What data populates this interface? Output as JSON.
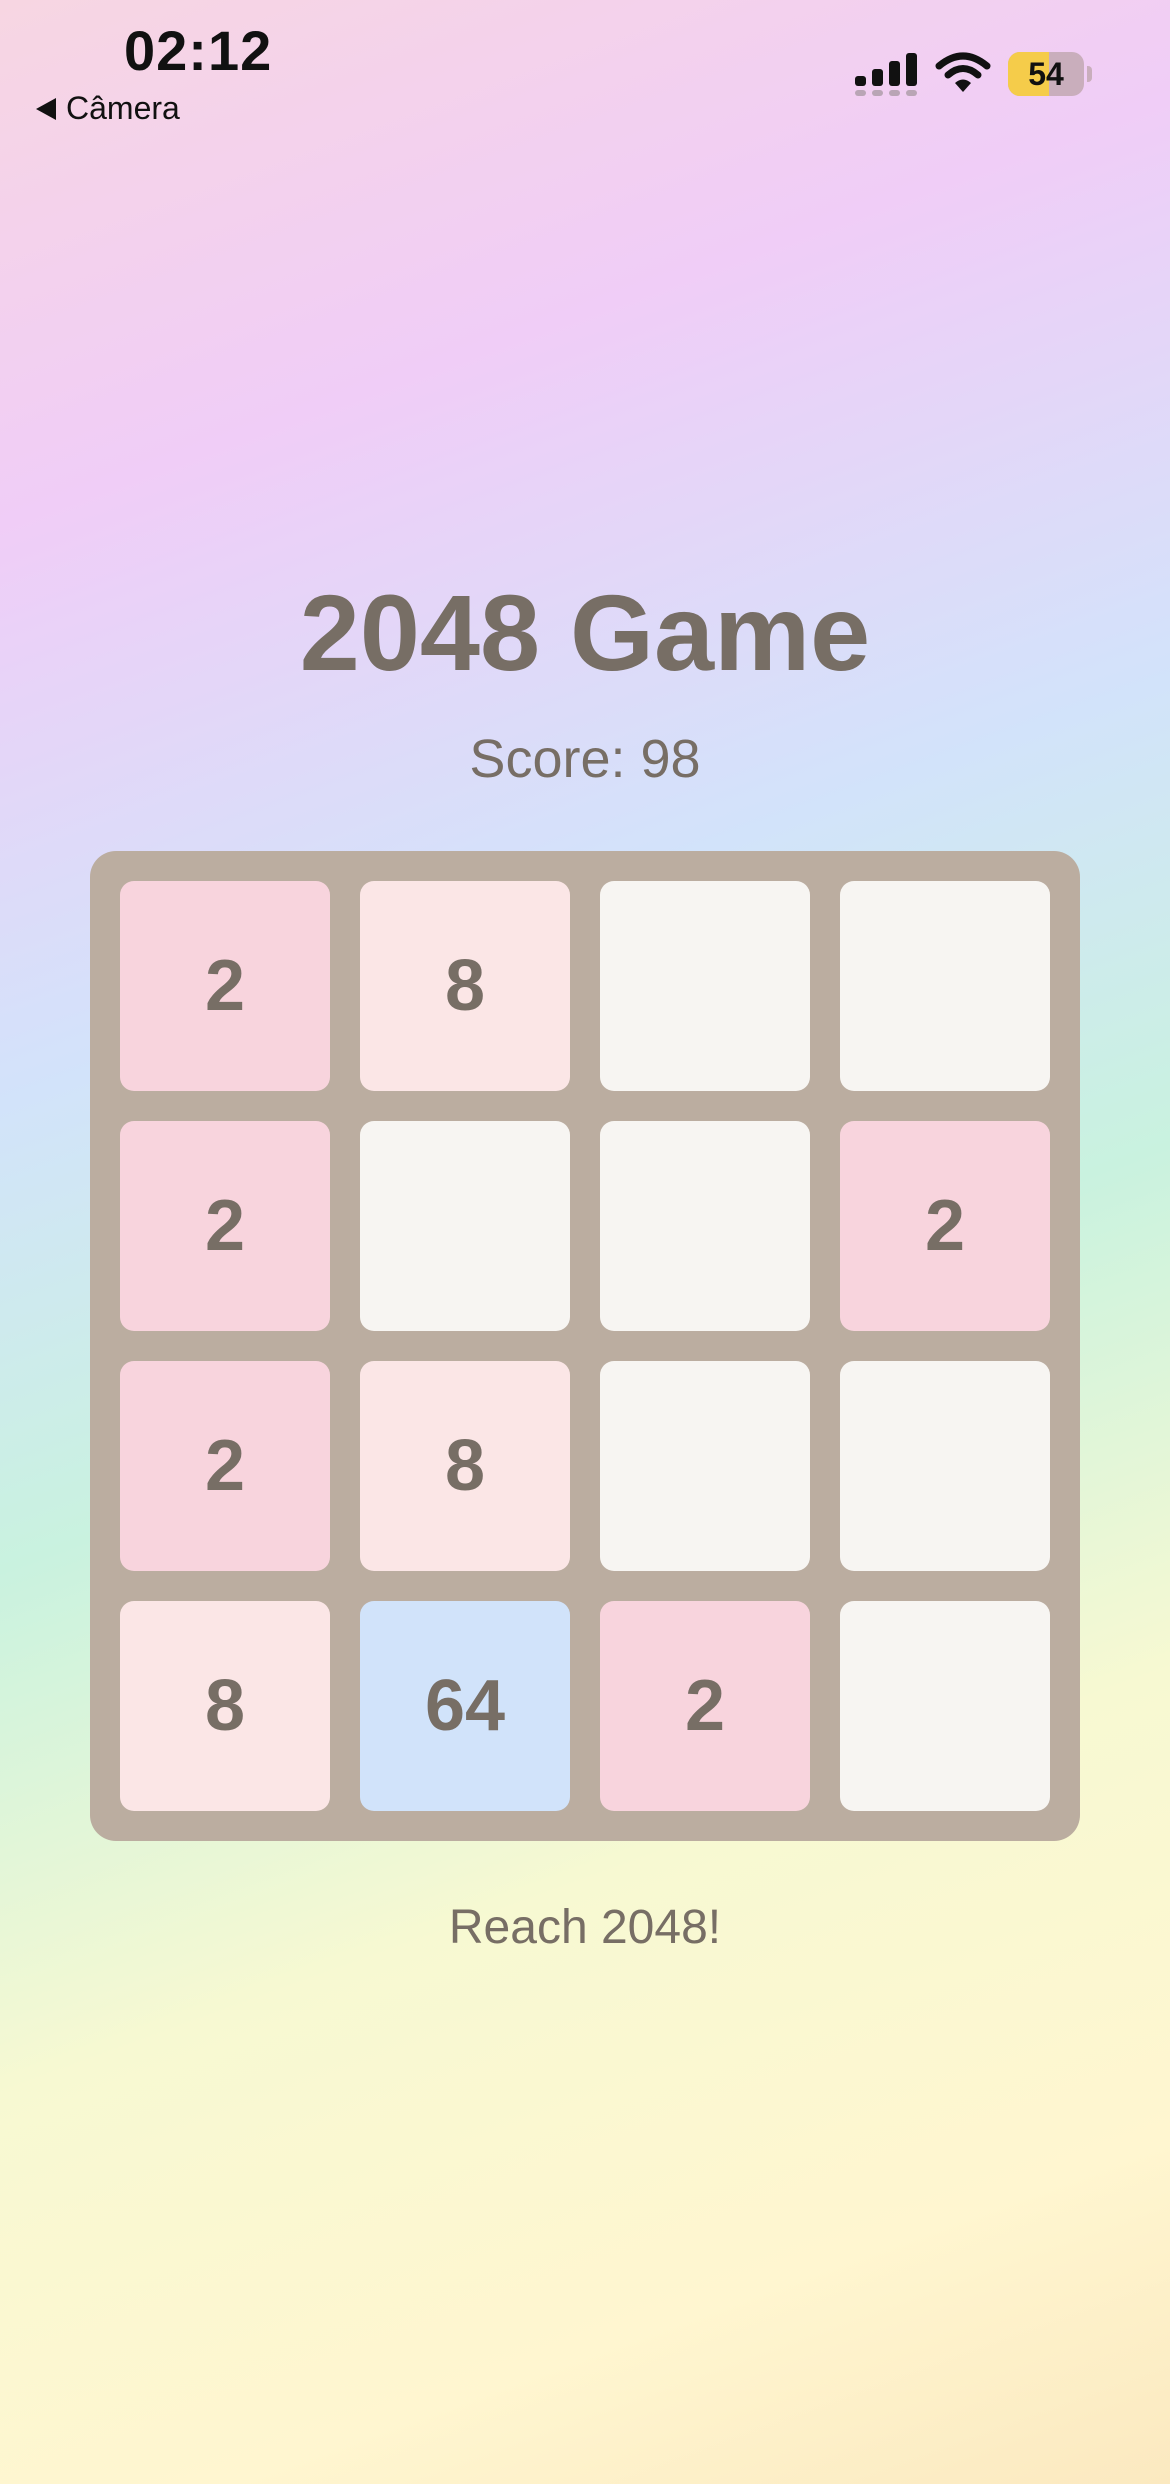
{
  "status_bar": {
    "time": "02:12",
    "back_label": "Câmera",
    "battery_level": "54",
    "battery_percent": 54,
    "icons": [
      "signal-icon",
      "wifi-icon",
      "battery-icon"
    ]
  },
  "game": {
    "title": "2048 Game",
    "score_text": "Score: 98",
    "hint": "Reach 2048!",
    "board": [
      [
        "2",
        "8",
        "",
        ""
      ],
      [
        "2",
        "",
        "",
        "2"
      ],
      [
        "2",
        "8",
        "",
        ""
      ],
      [
        "8",
        "64",
        "2",
        ""
      ]
    ]
  },
  "colors": {
    "text": "#776e65",
    "board": "#bbada0",
    "empty_tile": "#f7f5f2",
    "tile_2": "#f8d4dd",
    "tile_8": "#fbe6e6",
    "tile_64": "#d1e3fa",
    "battery_fill": "#f5cc4a"
  }
}
